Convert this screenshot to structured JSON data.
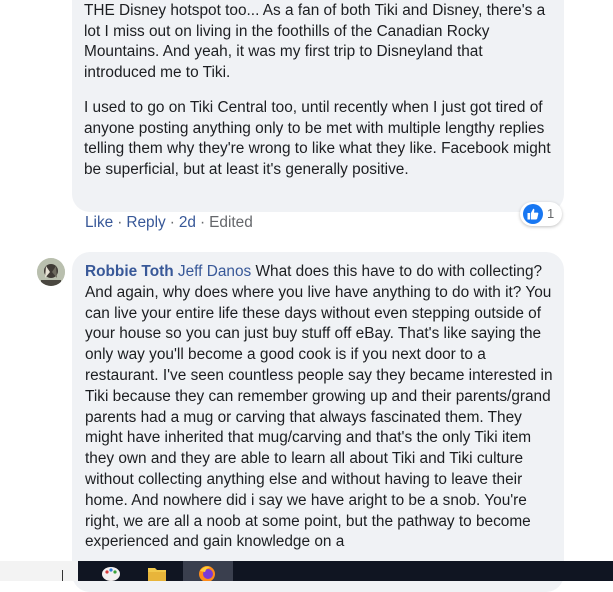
{
  "comment1": {
    "para1": "THE Disney hotspot too... As a fan of both Tiki and Disney, there's a lot I miss out on living in the foothills of the Canadian Rocky Mountains. And yeah, it was my first trip to Disneyland that introduced me to Tiki.",
    "para2": "I used to go on Tiki Central too, until recently when I just got tired of anyone posting anything only to be met with multiple lengthy replies telling them why they're wrong to like what they like. Facebook might be superficial, but at least it's generally positive.",
    "actions": {
      "like": "Like",
      "reply": "Reply",
      "time": "2d",
      "edited": "Edited",
      "sep": "·"
    },
    "reaction": {
      "icon": "like-thumb-icon",
      "count": "1",
      "color": "#1877f2"
    }
  },
  "comment2": {
    "author": "Robbie Toth",
    "mention": "Jeff Danos",
    "text": "What does this have to do with collecting? And again, why does where you live have anything to do with it? You can live your entire life these days without even stepping outside of your house so you can just buy stuff off eBay. That's like saying the only way you'll become a good cook is if you next door to a restaurant. I've seen countless people say they became interested in Tiki because they can remember growing up and their parents/grand parents had a mug or carving that always fascinated them. They might have inherited that mug/carving and that's the only Tiki item they own and they are able to learn all about Tiki and Tiki culture without collecting anything else and without having to leave their home. And nowhere did i say we have aright to be a snob. You're right, we are all a noob at some point, but the pathway to become experienced and gain knowledge on a"
  },
  "taskbar": {
    "icons": [
      "paint-icon",
      "file-explorer-icon",
      "firefox-icon"
    ]
  },
  "colors": {
    "link": "#385898",
    "bubble": "#f0f2f5",
    "meta": "#65676b"
  }
}
